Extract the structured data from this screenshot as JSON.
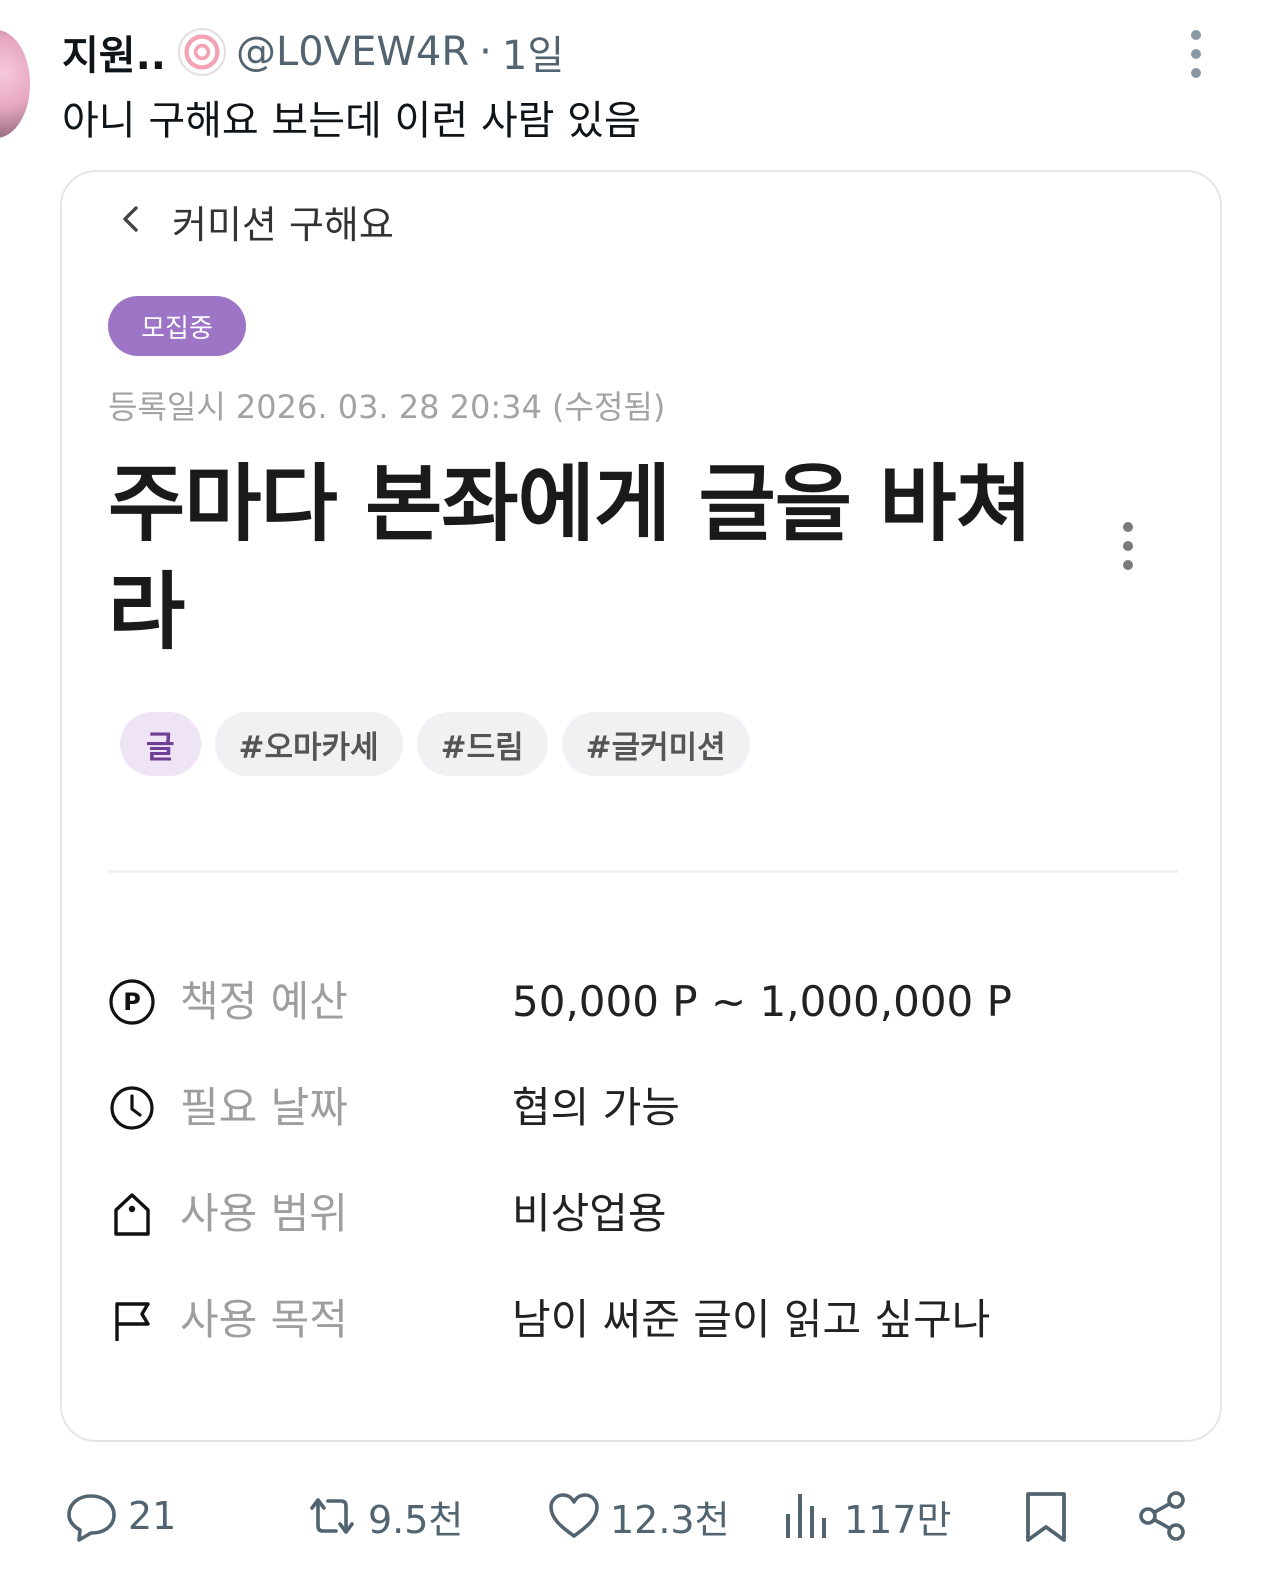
{
  "tweet": {
    "display_name": "지원..",
    "name_emoji": "naruto-fishcake-emoji",
    "handle": "@L0VEW4R",
    "separator": "·",
    "time": "1일",
    "text": "아니 구해요 보는데 이런 사람 있음"
  },
  "card": {
    "nav_title": "커미션 구해요",
    "status_badge": "모집중",
    "post_date": "등록일시 2026. 03. 28 20:34 (수정됨)",
    "title": "주마다 본좌에게 글을 바쳐라",
    "tags": [
      {
        "label": "글",
        "kind": "category"
      },
      {
        "label": "#오마카세",
        "kind": "hashtag"
      },
      {
        "label": "#드림",
        "kind": "hashtag"
      },
      {
        "label": "#글커미션",
        "kind": "hashtag"
      }
    ],
    "info": [
      {
        "icon": "point-icon",
        "label": "책정 예산",
        "value": "50,000 P ~ 1,000,000 P"
      },
      {
        "icon": "clock-icon",
        "label": "필요 날짜",
        "value": "협의 가능"
      },
      {
        "icon": "tag-icon",
        "label": "사용 범위",
        "value": "비상업용"
      },
      {
        "icon": "flag-icon",
        "label": "사용 목적",
        "value": "남이 써준 글이 읽고 싶구나"
      }
    ],
    "accent_color": "#9e74c6"
  },
  "actions": {
    "replies": "21",
    "reposts": "9.5천",
    "likes": "12.3천",
    "views": "117만"
  }
}
